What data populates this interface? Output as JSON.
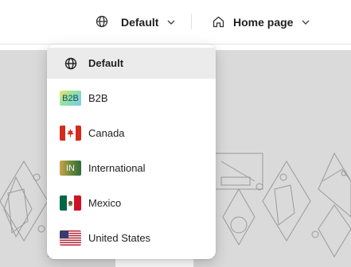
{
  "header": {
    "channel_selector": {
      "icon": "globe-icon",
      "label": "Default",
      "chevron": "chevron-down-icon"
    },
    "page_selector": {
      "icon": "home-icon",
      "label": "Home page",
      "chevron": "chevron-down-icon"
    }
  },
  "dropdown": {
    "items": [
      {
        "label": "Default",
        "icon": "globe-icon",
        "selected": true
      },
      {
        "label": "B2B",
        "icon": "b2b-flag-icon",
        "badge": "B2B"
      },
      {
        "label": "Canada",
        "icon": "canada-flag-icon"
      },
      {
        "label": "International",
        "icon": "international-flag-icon",
        "badge": "IN"
      },
      {
        "label": "Mexico",
        "icon": "mexico-flag-icon"
      },
      {
        "label": "United States",
        "icon": "us-flag-icon"
      }
    ]
  },
  "colors": {
    "background_canvas": "#dadada",
    "selected_item": "#ebebeb",
    "text": "#1f1f1f"
  }
}
